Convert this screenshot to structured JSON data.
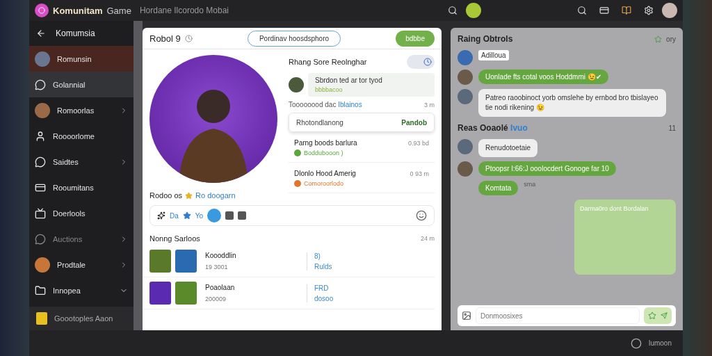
{
  "header": {
    "brand": "Komunitam",
    "title": "Game",
    "subtitle": "Hordane Ilcorodo Mobai"
  },
  "sidebar": {
    "title": "Komumsia",
    "items": [
      {
        "label": "Romunsin",
        "kind": "avatar",
        "selected": true,
        "highlighted": false,
        "dimmed": false,
        "expandable": false,
        "expanded": false,
        "color": "#6a7590"
      },
      {
        "label": "Golannial",
        "kind": "chat",
        "selected": false,
        "highlighted": true,
        "dimmed": false,
        "expandable": false,
        "expanded": false
      },
      {
        "label": "Romoorlas",
        "kind": "avatar",
        "selected": false,
        "highlighted": false,
        "dimmed": false,
        "expandable": true,
        "expanded": false,
        "color": "#9a6a48"
      },
      {
        "label": "Roooorlome",
        "kind": "user",
        "selected": false,
        "highlighted": false,
        "dimmed": false,
        "expandable": false,
        "expanded": false
      },
      {
        "label": "Saidtes",
        "kind": "chat",
        "selected": false,
        "highlighted": false,
        "dimmed": false,
        "expandable": true,
        "expanded": false
      },
      {
        "label": "Rooumitans",
        "kind": "card",
        "selected": false,
        "highlighted": false,
        "dimmed": false,
        "expandable": false,
        "expanded": false
      },
      {
        "label": "Doerlools",
        "kind": "tv",
        "selected": false,
        "highlighted": false,
        "dimmed": false,
        "expandable": false,
        "expanded": false
      },
      {
        "label": "Auctions",
        "kind": "chat",
        "selected": false,
        "highlighted": false,
        "dimmed": true,
        "expandable": true,
        "expanded": false
      },
      {
        "label": "Prodtale",
        "kind": "avatar",
        "selected": false,
        "highlighted": false,
        "dimmed": false,
        "expandable": true,
        "expanded": false,
        "color": "#c7763a"
      },
      {
        "label": "Innopea",
        "kind": "folder",
        "selected": false,
        "highlighted": false,
        "dimmed": false,
        "expandable": true,
        "expanded": true
      }
    ],
    "footer": "Goootoples Aaon"
  },
  "profile": {
    "title": "Robol 9",
    "pill_button": "Pordinav hoosdsphoro",
    "action_button": "bdbbe",
    "caption": "Rodoo os",
    "caption_link": "Ro doogarn",
    "toolbar": {
      "label_1": "Da",
      "label_2": "Yo"
    }
  },
  "activity": {
    "heading": "Rhang Sore Reolnghar",
    "toggle": {
      "on": true
    },
    "comment": {
      "text": "Sbrdon ted ar tor tyod",
      "sub": "bbbbacoo"
    },
    "meta": {
      "text": "Toooooood dac",
      "link": "Iblainos",
      "time": "3 m"
    },
    "select": {
      "label": "Rhotondlanong",
      "value": "Pandob"
    },
    "items": [
      {
        "title": "Parng boods barlura",
        "time": "0.93 bd",
        "status": "Boddubooon )",
        "color": "#5aa83a"
      },
      {
        "title": "Dlonlo Hood Amerig",
        "time": "0 93 m",
        "status": "Comoroorlodo",
        "color": "#e0762a"
      }
    ]
  },
  "recent": {
    "heading": "Nonng Sarloos",
    "time": "24 m",
    "rows": [
      {
        "name": "Koooddlin",
        "value": "19 3001",
        "tag": "8)",
        "sub": "Rulds"
      },
      {
        "name": "Poaolaan",
        "value": "200009",
        "tag": "FRD",
        "sub": "dosoo"
      }
    ]
  },
  "chat": {
    "title": "Raing Obtrols",
    "corner": "ory",
    "messages": [
      {
        "kind": "tag",
        "text": "Adilloua"
      },
      {
        "kind": "green",
        "text": "Uonlade fts cotal voos Hoddmmi 😉✔"
      },
      {
        "kind": "received",
        "text": "Patreo raoobinoct yorb omslehe by ernbod bro tbislayeo tie nodi rikening 😉"
      },
      {
        "kind": "section",
        "text": "Reas Ooaolé",
        "link": "Ivuo",
        "time": "11"
      },
      {
        "kind": "received",
        "text": "Renudotoetaie"
      },
      {
        "kind": "green",
        "text": "Ptoopsr I:66:J ooolocdert Gonoge far 10"
      },
      {
        "kind": "small",
        "text": "Komtata",
        "sub": "sma"
      },
      {
        "kind": "sent",
        "text": "Darma0ro dont Bordalan"
      }
    ],
    "input": {
      "placeholder": "Donmoosixes"
    },
    "footer": "Iumoon"
  }
}
